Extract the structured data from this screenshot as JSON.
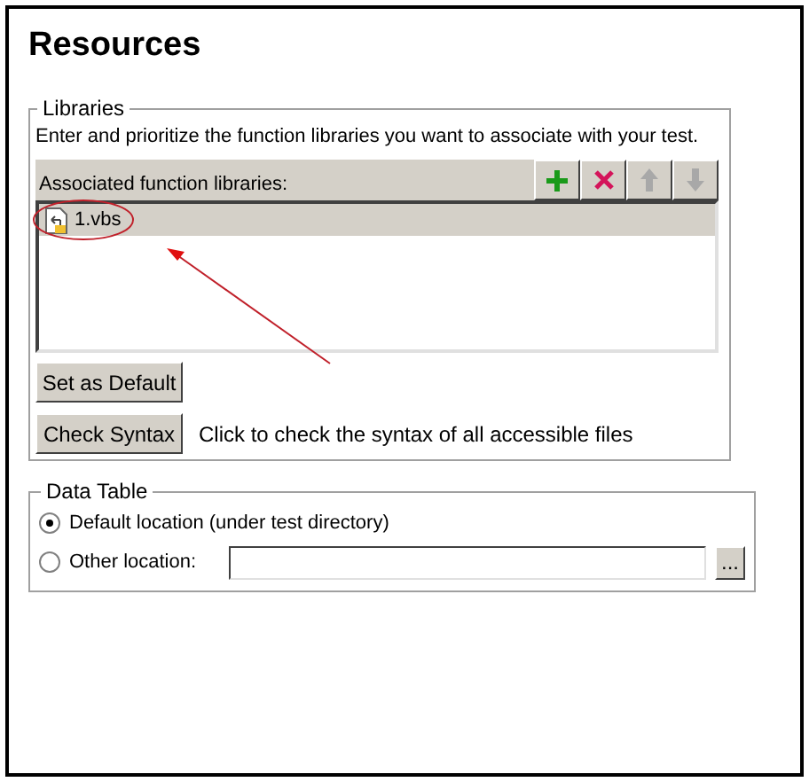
{
  "title": "Resources",
  "libraries": {
    "legend": "Libraries",
    "description": "Enter and prioritize the function libraries you want to associate with your test.",
    "list_label": "Associated function libraries:",
    "toolbar": [
      {
        "kind": "add"
      },
      {
        "kind": "remove"
      },
      {
        "kind": "up"
      },
      {
        "kind": "down"
      }
    ],
    "items": [
      {
        "name": "1.vbs",
        "selected": true
      }
    ],
    "buttons": [
      {
        "label": "Set as Default"
      },
      {
        "label": "Check Syntax",
        "hint": "Click to check the syntax of all accessible files"
      }
    ]
  },
  "data_table": {
    "legend": "Data Table",
    "options": [
      {
        "kind": "plain",
        "label": "Default location (under test directory)",
        "selected": true
      },
      {
        "kind": "with_field",
        "label": "Other location:",
        "selected": false
      }
    ],
    "browse": "..."
  }
}
